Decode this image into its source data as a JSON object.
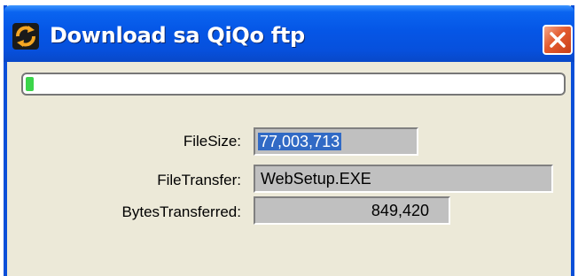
{
  "window": {
    "title": "Download sa QiQo ftp",
    "app_icon": "qiqo-app-icon",
    "close_icon": "close-icon"
  },
  "progress": {
    "fraction": 0.015,
    "accent": "#3bd54a"
  },
  "fields": {
    "filesize_label": "FileSize:",
    "filesize_value": "77,003,713",
    "filetransfer_label": "FileTransfer:",
    "filetransfer_value": "WebSetup.EXE",
    "bytes_label": "BytesTransferred:",
    "bytes_value": "849,420"
  },
  "colors": {
    "title_bar": "#0556e6",
    "close_button": "#e35a2e",
    "selection": "#316ac5",
    "window_bg": "#ece9d8"
  }
}
